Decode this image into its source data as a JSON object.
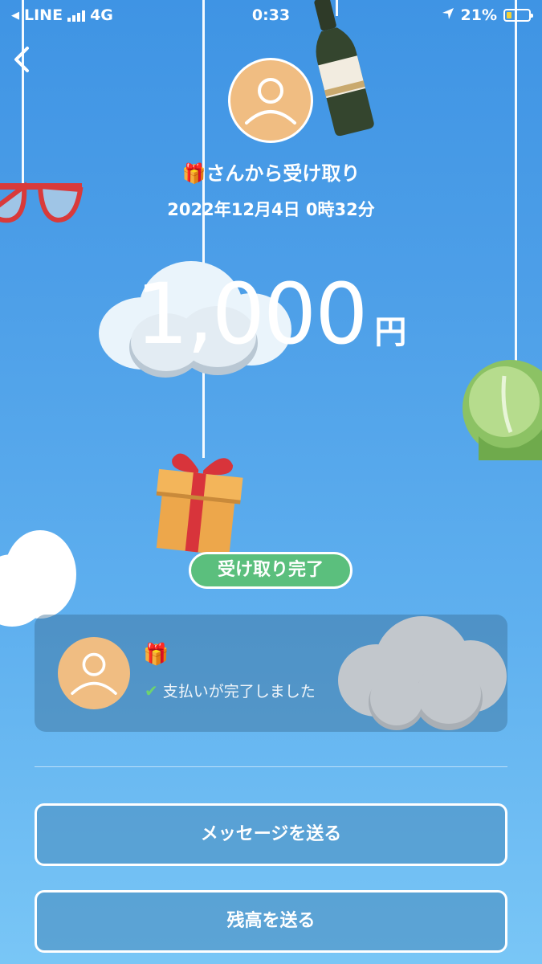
{
  "status_bar": {
    "carrier": "LINE",
    "network": "4G",
    "time": "0:33",
    "battery_percent": "21%"
  },
  "header": {
    "back_icon": "chevron-left-icon"
  },
  "sender": {
    "gift_emoji": "🎁",
    "from_text": "さんから受け取り",
    "datetime": "2022年12月4日 0時32分"
  },
  "amount": {
    "value": "1,000",
    "unit": "円"
  },
  "badge": {
    "label": "受け取り完了",
    "color": "#5bbf7d"
  },
  "message_card": {
    "gift_emoji": "🎁",
    "status_icon": "check-icon",
    "status_text": "支払いが完了しました"
  },
  "actions": {
    "send_message_label": "メッセージを送る",
    "send_balance_label": "残高を送る"
  },
  "colors": {
    "background_top": "#3f94e4",
    "background_bottom": "#79c6f6",
    "avatar": "#f0bd82",
    "success": "#5bbf7d"
  }
}
